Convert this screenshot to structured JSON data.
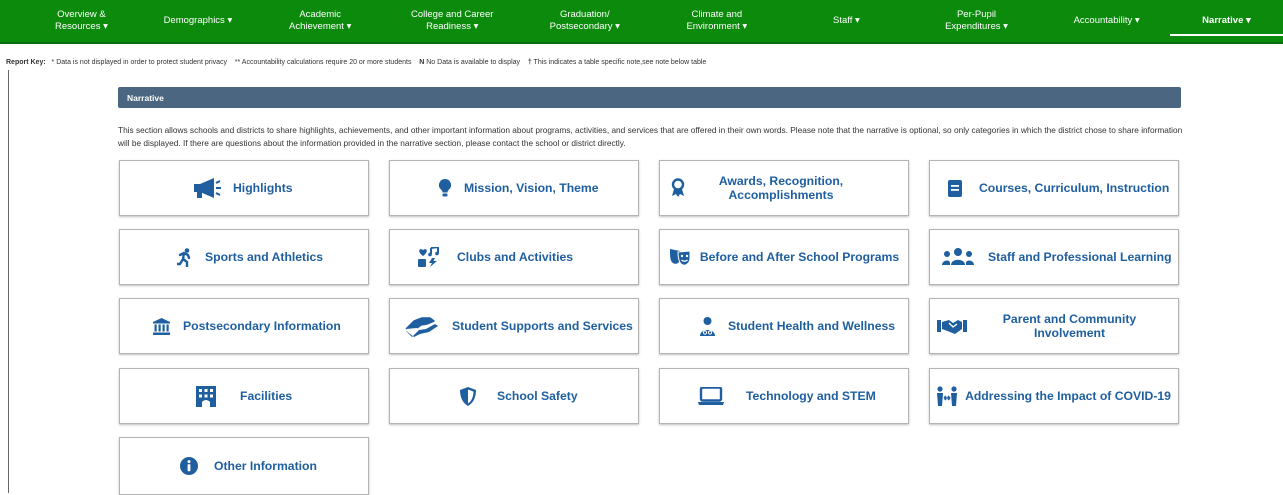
{
  "nav": {
    "items": [
      {
        "line1": "Overview &",
        "line2": "Resources ▾"
      },
      {
        "line1": "Demographics ▾",
        "line2": ""
      },
      {
        "line1": "Academic",
        "line2": "Achievement ▾"
      },
      {
        "line1": "College and Career",
        "line2": "Readiness ▾"
      },
      {
        "line1": "Graduation/",
        "line2": "Postsecondary ▾"
      },
      {
        "line1": "Climate and",
        "line2": "Environment ▾"
      },
      {
        "line1": "Staff ▾",
        "line2": ""
      },
      {
        "line1": "Per-Pupil",
        "line2": "Expenditures ▾"
      },
      {
        "line1": "Accountability ▾",
        "line2": ""
      },
      {
        "line1": "Narrative ▾",
        "line2": ""
      }
    ]
  },
  "report_key": {
    "label": "Report Key:",
    "note1": "* Data is not displayed in order to protect student privacy",
    "note2": "** Accountability calculations require 20 or more students",
    "note3_bold": "N",
    "note3": "No Data is available to display",
    "note4_bold": "†",
    "note4": "This indicates a table specific note,see note below table"
  },
  "section": {
    "title": "Narrative",
    "intro": "This section allows schools and districts to share highlights, achievements, and other important information about programs, activities, and services that are offered in their own words. Please note that the narrative is optional, so only categories in which the district chose to share information will be displayed. If there are questions about the information provided in the narrative section, please contact the school or district directly."
  },
  "cards": [
    {
      "label": "Highlights",
      "icon": "megaphone-icon"
    },
    {
      "label": "Mission, Vision, Theme",
      "icon": "lightbulb-icon"
    },
    {
      "label": "Awards, Recognition, Accomplishments",
      "icon": "award-icon"
    },
    {
      "label": "Courses, Curriculum, Instruction",
      "icon": "book-icon"
    },
    {
      "label": "Sports and Athletics",
      "icon": "running-icon"
    },
    {
      "label": "Clubs and Activities",
      "icon": "activities-icon"
    },
    {
      "label": "Before and After School Programs",
      "icon": "theater-masks-icon"
    },
    {
      "label": "Staff and Professional Learning",
      "icon": "users-icon"
    },
    {
      "label": "Postsecondary Information",
      "icon": "university-icon"
    },
    {
      "label": "Student Supports and Services",
      "icon": "hands-helping-icon"
    },
    {
      "label": "Student Health and Wellness",
      "icon": "user-md-icon"
    },
    {
      "label": "Parent and Community Involvement",
      "icon": "handshake-icon"
    },
    {
      "label": "Facilities",
      "icon": "building-icon"
    },
    {
      "label": "School Safety",
      "icon": "shield-icon"
    },
    {
      "label": "Technology and STEM",
      "icon": "laptop-icon"
    },
    {
      "label": "Addressing the Impact of COVID-19",
      "icon": "people-arrows-icon"
    },
    {
      "label": "Other Information",
      "icon": "info-circle-icon"
    }
  ],
  "colors": {
    "nav_green": "#0b8a0b",
    "section_bar": "#4a6680",
    "card_text": "#1f5fa0"
  }
}
